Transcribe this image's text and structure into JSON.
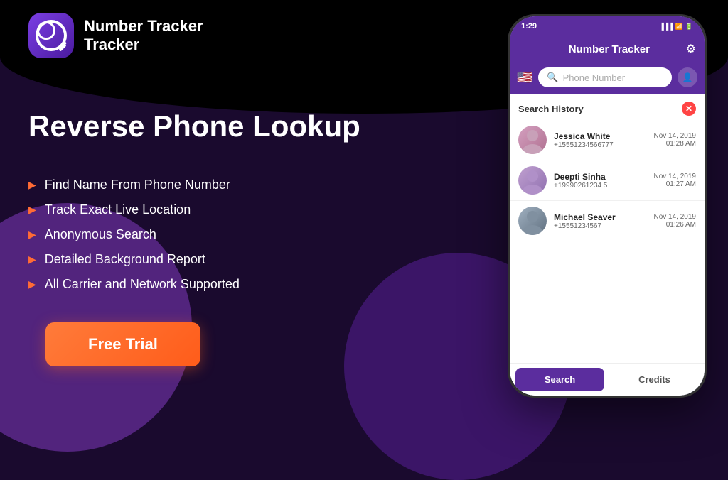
{
  "app": {
    "name": "Number Tracker",
    "tagline": "Number\nTracker"
  },
  "background": {
    "color": "#1a0a2e"
  },
  "left": {
    "headline": "Reverse Phone Lookup",
    "features": [
      "Find Name From Phone Number",
      "Track Exact Live Location",
      "Anonymous Search",
      "Detailed Background Report",
      "All Carrier and Network Supported"
    ],
    "cta_button": "Free Trial"
  },
  "phone": {
    "status_bar": {
      "time": "1:29",
      "icons": "▐▐ ▐ 🔋"
    },
    "header": {
      "title": "Number Tracker",
      "gear_icon": "⚙"
    },
    "search": {
      "placeholder": "Phone Number",
      "flag": "🇺🇸"
    },
    "history": {
      "title": "Search History",
      "contacts": [
        {
          "name": "Jessica White",
          "phone": "+15551234566777",
          "date": "Nov 14, 2019",
          "time": "01:28 AM"
        },
        {
          "name": "Deepti Sinha",
          "phone": "+19990261234 5",
          "date": "Nov 14, 2019",
          "time": "01:27 AM"
        },
        {
          "name": "Michael Seaver",
          "phone": "+15551234567",
          "date": "Nov 14, 2019",
          "time": "01:26 AM"
        }
      ]
    },
    "tabs": {
      "search": "Search",
      "credits": "Credits"
    }
  }
}
